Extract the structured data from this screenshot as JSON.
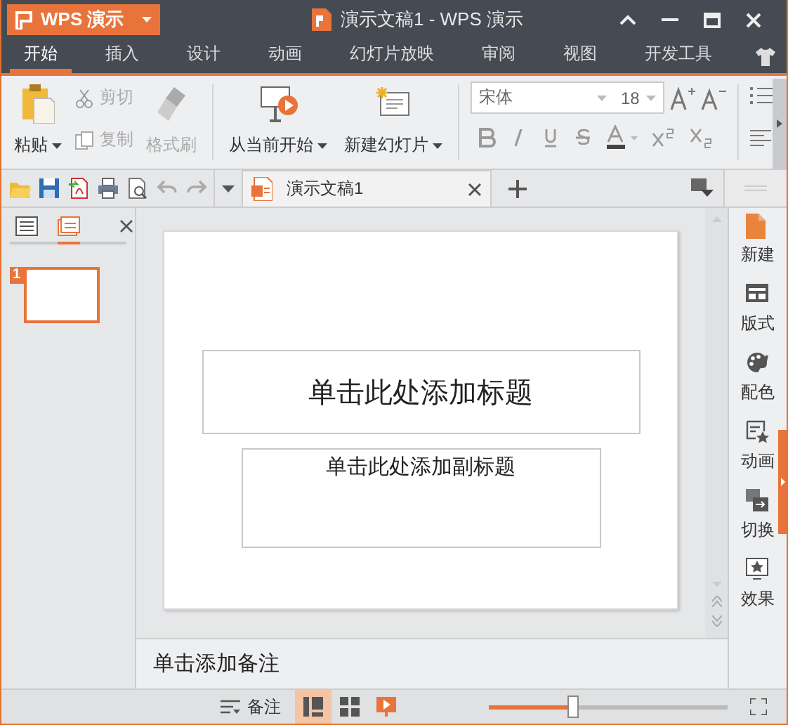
{
  "window": {
    "app_button": "WPS 演示",
    "title": "演示文稿1 - WPS 演示"
  },
  "tabs": [
    {
      "label": "开始",
      "selected": true
    },
    {
      "label": "插入",
      "selected": false
    },
    {
      "label": "设计",
      "selected": false
    },
    {
      "label": "动画",
      "selected": false
    },
    {
      "label": "幻灯片放映",
      "selected": false
    },
    {
      "label": "审阅",
      "selected": false
    },
    {
      "label": "视图",
      "selected": false
    },
    {
      "label": "开发工具",
      "selected": false
    }
  ],
  "ribbon": {
    "paste": "粘贴",
    "cut": "剪切",
    "copy": "复制",
    "format_painter": "格式刷",
    "play_from_current": "从当前开始",
    "new_slide": "新建幻灯片",
    "font": "宋体",
    "font_size": "18"
  },
  "document_tab": {
    "title": "演示文稿1"
  },
  "slide": {
    "title_placeholder": "单击此处添加标题",
    "subtitle_placeholder": "单击此处添加副标题"
  },
  "thumbnails": [
    {
      "number": "1",
      "selected": true
    }
  ],
  "notes": {
    "placeholder": "单击添加备注"
  },
  "sidebar": {
    "items": [
      {
        "label": "新建"
      },
      {
        "label": "版式"
      },
      {
        "label": "配色"
      },
      {
        "label": "动画"
      },
      {
        "label": "切换"
      },
      {
        "label": "效果"
      }
    ]
  },
  "status_bar": {
    "notes_button": "备注",
    "zoom": {
      "level": 0.35
    }
  }
}
